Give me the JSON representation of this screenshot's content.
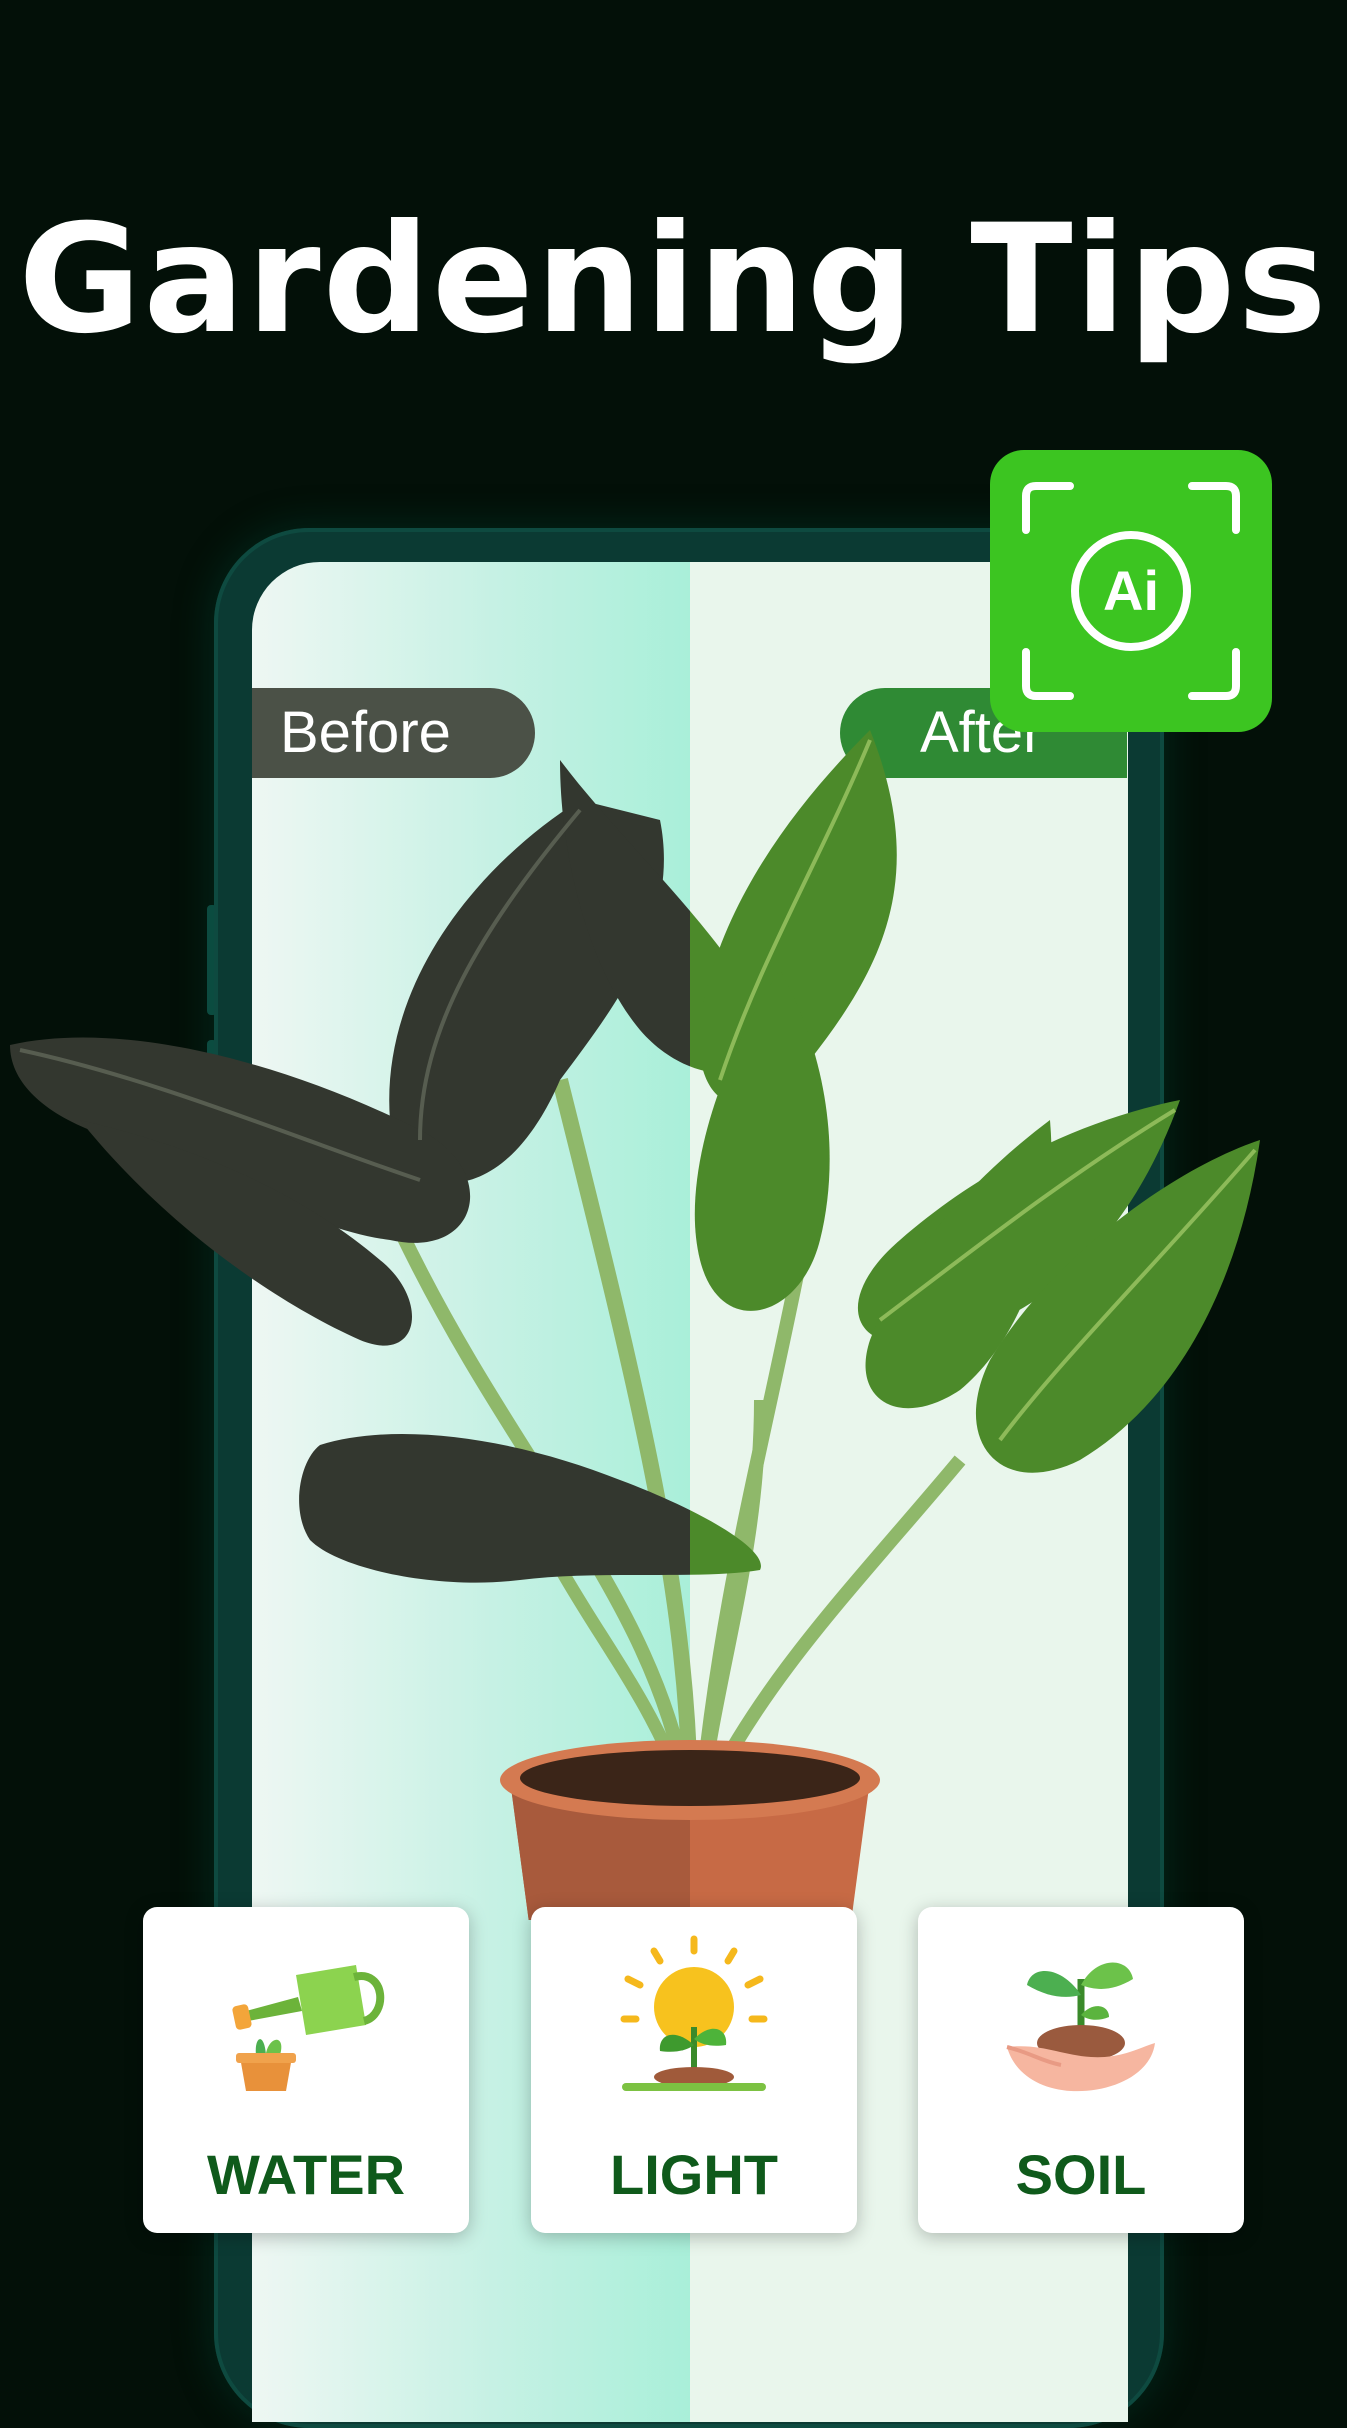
{
  "headline": "Gardening Tips",
  "comparison": {
    "before_label": "Before",
    "after_label": "After"
  },
  "badge": {
    "text": "Ai",
    "icon": "ai-scan-icon",
    "color": "#3cc521"
  },
  "cards": [
    {
      "label": "WATER",
      "icon": "watering-can-icon"
    },
    {
      "label": "LIGHT",
      "icon": "sun-plant-icon"
    },
    {
      "label": "SOIL",
      "icon": "soil-sprout-icon"
    }
  ],
  "colors": {
    "background": "#031008",
    "phone_frame": "#0b3a33",
    "card_label": "#0f5a1b",
    "after_pill": "#2f8a34",
    "before_pill": "#4b5147"
  }
}
